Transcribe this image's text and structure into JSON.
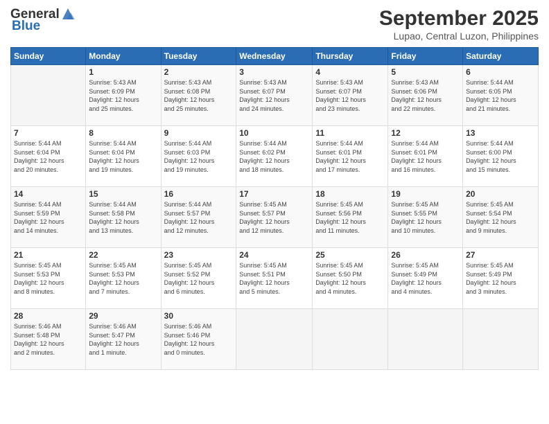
{
  "header": {
    "logo_general": "General",
    "logo_blue": "Blue",
    "month": "September 2025",
    "location": "Lupao, Central Luzon, Philippines"
  },
  "days_of_week": [
    "Sunday",
    "Monday",
    "Tuesday",
    "Wednesday",
    "Thursday",
    "Friday",
    "Saturday"
  ],
  "weeks": [
    [
      {
        "day": "",
        "info": ""
      },
      {
        "day": "1",
        "info": "Sunrise: 5:43 AM\nSunset: 6:09 PM\nDaylight: 12 hours\nand 25 minutes."
      },
      {
        "day": "2",
        "info": "Sunrise: 5:43 AM\nSunset: 6:08 PM\nDaylight: 12 hours\nand 25 minutes."
      },
      {
        "day": "3",
        "info": "Sunrise: 5:43 AM\nSunset: 6:07 PM\nDaylight: 12 hours\nand 24 minutes."
      },
      {
        "day": "4",
        "info": "Sunrise: 5:43 AM\nSunset: 6:07 PM\nDaylight: 12 hours\nand 23 minutes."
      },
      {
        "day": "5",
        "info": "Sunrise: 5:43 AM\nSunset: 6:06 PM\nDaylight: 12 hours\nand 22 minutes."
      },
      {
        "day": "6",
        "info": "Sunrise: 5:44 AM\nSunset: 6:05 PM\nDaylight: 12 hours\nand 21 minutes."
      }
    ],
    [
      {
        "day": "7",
        "info": "Sunrise: 5:44 AM\nSunset: 6:04 PM\nDaylight: 12 hours\nand 20 minutes."
      },
      {
        "day": "8",
        "info": "Sunrise: 5:44 AM\nSunset: 6:04 PM\nDaylight: 12 hours\nand 19 minutes."
      },
      {
        "day": "9",
        "info": "Sunrise: 5:44 AM\nSunset: 6:03 PM\nDaylight: 12 hours\nand 19 minutes."
      },
      {
        "day": "10",
        "info": "Sunrise: 5:44 AM\nSunset: 6:02 PM\nDaylight: 12 hours\nand 18 minutes."
      },
      {
        "day": "11",
        "info": "Sunrise: 5:44 AM\nSunset: 6:01 PM\nDaylight: 12 hours\nand 17 minutes."
      },
      {
        "day": "12",
        "info": "Sunrise: 5:44 AM\nSunset: 6:01 PM\nDaylight: 12 hours\nand 16 minutes."
      },
      {
        "day": "13",
        "info": "Sunrise: 5:44 AM\nSunset: 6:00 PM\nDaylight: 12 hours\nand 15 minutes."
      }
    ],
    [
      {
        "day": "14",
        "info": "Sunrise: 5:44 AM\nSunset: 5:59 PM\nDaylight: 12 hours\nand 14 minutes."
      },
      {
        "day": "15",
        "info": "Sunrise: 5:44 AM\nSunset: 5:58 PM\nDaylight: 12 hours\nand 13 minutes."
      },
      {
        "day": "16",
        "info": "Sunrise: 5:44 AM\nSunset: 5:57 PM\nDaylight: 12 hours\nand 12 minutes."
      },
      {
        "day": "17",
        "info": "Sunrise: 5:45 AM\nSunset: 5:57 PM\nDaylight: 12 hours\nand 12 minutes."
      },
      {
        "day": "18",
        "info": "Sunrise: 5:45 AM\nSunset: 5:56 PM\nDaylight: 12 hours\nand 11 minutes."
      },
      {
        "day": "19",
        "info": "Sunrise: 5:45 AM\nSunset: 5:55 PM\nDaylight: 12 hours\nand 10 minutes."
      },
      {
        "day": "20",
        "info": "Sunrise: 5:45 AM\nSunset: 5:54 PM\nDaylight: 12 hours\nand 9 minutes."
      }
    ],
    [
      {
        "day": "21",
        "info": "Sunrise: 5:45 AM\nSunset: 5:53 PM\nDaylight: 12 hours\nand 8 minutes."
      },
      {
        "day": "22",
        "info": "Sunrise: 5:45 AM\nSunset: 5:53 PM\nDaylight: 12 hours\nand 7 minutes."
      },
      {
        "day": "23",
        "info": "Sunrise: 5:45 AM\nSunset: 5:52 PM\nDaylight: 12 hours\nand 6 minutes."
      },
      {
        "day": "24",
        "info": "Sunrise: 5:45 AM\nSunset: 5:51 PM\nDaylight: 12 hours\nand 5 minutes."
      },
      {
        "day": "25",
        "info": "Sunrise: 5:45 AM\nSunset: 5:50 PM\nDaylight: 12 hours\nand 4 minutes."
      },
      {
        "day": "26",
        "info": "Sunrise: 5:45 AM\nSunset: 5:49 PM\nDaylight: 12 hours\nand 4 minutes."
      },
      {
        "day": "27",
        "info": "Sunrise: 5:45 AM\nSunset: 5:49 PM\nDaylight: 12 hours\nand 3 minutes."
      }
    ],
    [
      {
        "day": "28",
        "info": "Sunrise: 5:46 AM\nSunset: 5:48 PM\nDaylight: 12 hours\nand 2 minutes."
      },
      {
        "day": "29",
        "info": "Sunrise: 5:46 AM\nSunset: 5:47 PM\nDaylight: 12 hours\nand 1 minute."
      },
      {
        "day": "30",
        "info": "Sunrise: 5:46 AM\nSunset: 5:46 PM\nDaylight: 12 hours\nand 0 minutes."
      },
      {
        "day": "",
        "info": ""
      },
      {
        "day": "",
        "info": ""
      },
      {
        "day": "",
        "info": ""
      },
      {
        "day": "",
        "info": ""
      }
    ]
  ]
}
